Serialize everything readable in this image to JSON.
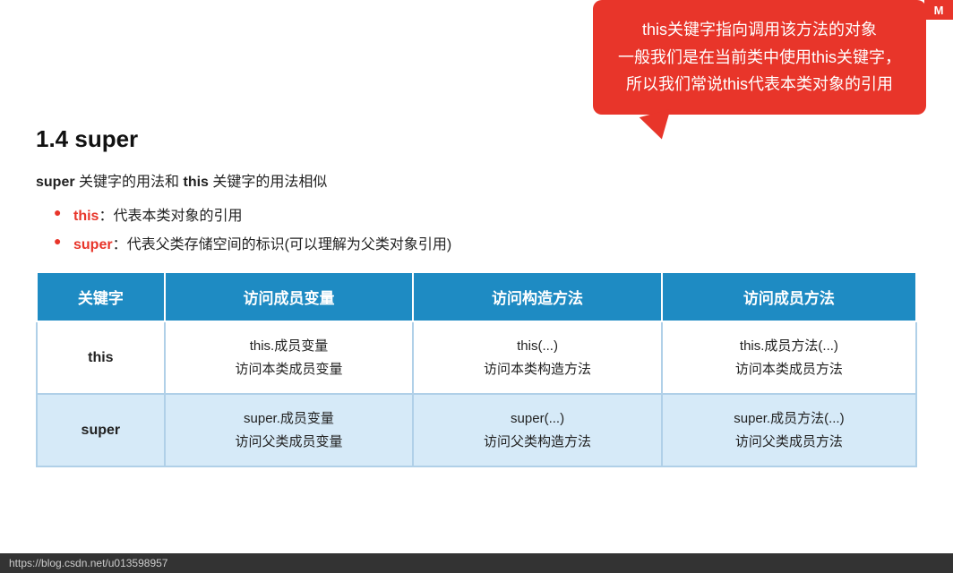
{
  "badge": {
    "label": "M"
  },
  "callout": {
    "line1": "this关键字指向调用该方法的对象",
    "line2": "一般我们是在当前类中使用this关键字，",
    "line3": "所以我们常说this代表本类对象的引用"
  },
  "section": {
    "heading": "1.4 super",
    "description_prefix": "super",
    "description_middle": " 关键字的用法和 ",
    "description_this": "this",
    "description_suffix": " 关键字的用法相似"
  },
  "bullets": [
    {
      "keyword": "this",
      "colon": "：",
      "text": "代表本类对象的引用"
    },
    {
      "keyword": "super",
      "colon": "：",
      "text": "代表父类存储空间的标识(可以理解为父类对象引用)"
    }
  ],
  "table": {
    "headers": [
      "关键字",
      "访问成员变量",
      "访问构造方法",
      "访问成员方法"
    ],
    "rows": [
      {
        "keyword": "this",
        "member_var": "this.成员变量\n访问本类成员变量",
        "constructor": "this(...)\n访问本类构造方法",
        "member_method": "this.成员方法(...)\n访问本类成员方法",
        "even": false
      },
      {
        "keyword": "super",
        "member_var": "super.成员变量\n访问父类成员变量",
        "constructor": "super(...)\n访问父类构造方法",
        "member_method": "super.成员方法(...)\n访问父类成员方法",
        "even": true
      }
    ]
  },
  "url_bar": {
    "text": "https://blog.csdn.net/u013598957"
  }
}
